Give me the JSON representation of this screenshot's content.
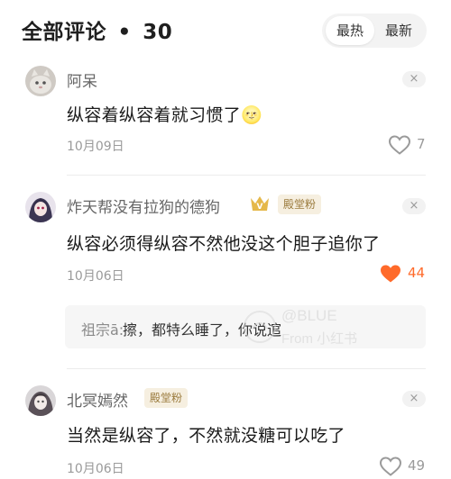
{
  "header": {
    "title": "全部评论",
    "dot": "•",
    "count": "30",
    "sort_options": [
      "最热",
      "最新"
    ],
    "sort_selected": "最热"
  },
  "comments": [
    {
      "user": "阿呆",
      "text": "纵容着纵容着就习惯了",
      "emoji": "🌝",
      "date": "10月09日",
      "likes": "7",
      "liked": false,
      "close": "×"
    },
    {
      "user": "炸天帮没有拉狗的德狗",
      "crown_letter": "V",
      "badge": "殿堂粉",
      "text": "纵容必须得纵容不然他没这个胆子追你了",
      "date": "10月06日",
      "likes": "44",
      "liked": true,
      "close": "×",
      "reply": {
        "user": "祖宗ā:",
        "text": "擦，都特么睡了，你说逭"
      }
    },
    {
      "user": "北冥嫣然",
      "badge": "殿堂粉",
      "text": "当然是纵容了，不然就没糖可以吃了",
      "date": "10月06日",
      "likes": "49",
      "liked": false,
      "close": "×"
    }
  ],
  "watermark": {
    "line1": "@BLUE",
    "line2": "From 小红书"
  },
  "colors": {
    "liked": "#ff6a2a",
    "muted": "#9a9a9a",
    "badge_bg": "#f6efe0",
    "badge_text": "#9a7a3c"
  }
}
